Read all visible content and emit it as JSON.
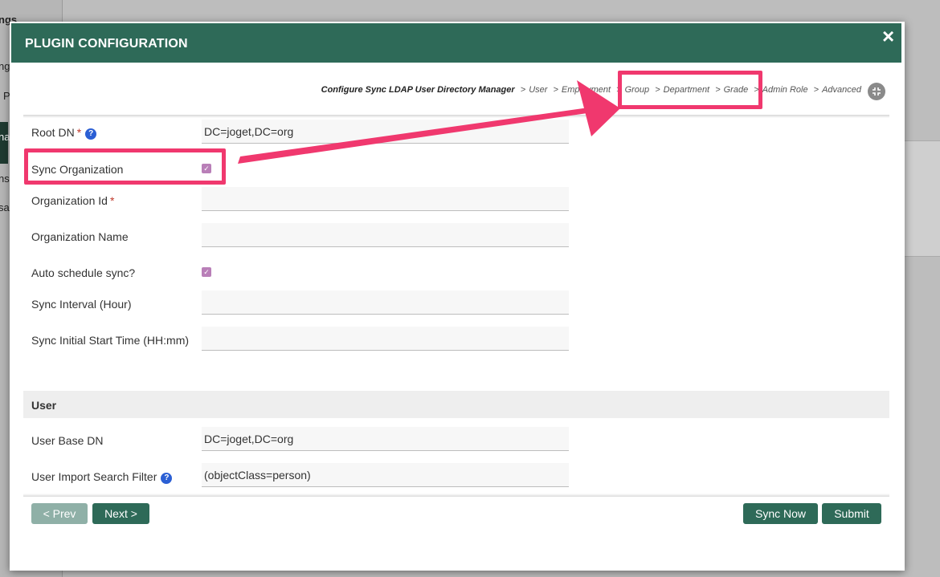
{
  "background": {
    "sidebar_fragments": [
      "ngs",
      "ng",
      "P",
      "na",
      "ns",
      "sa"
    ]
  },
  "modal": {
    "title": "PLUGIN CONFIGURATION",
    "close_glyph": "×"
  },
  "breadcrumb": {
    "root": "Configure Sync LDAP User Directory Manager",
    "separator": ">",
    "steps": [
      "User",
      "Employment",
      "Group",
      "Department",
      "Grade",
      "Admin Role",
      "Advanced"
    ],
    "collapse_icon": "collapse-icon"
  },
  "form": {
    "root_dn": {
      "label": "Root DN",
      "required": "*",
      "value": "DC=joget,DC=org"
    },
    "sync_organization": {
      "label": "Sync Organization",
      "checked": true
    },
    "organization_id": {
      "label": "Organization Id",
      "required": "*",
      "value": ""
    },
    "organization_name": {
      "label": "Organization Name",
      "value": ""
    },
    "auto_schedule": {
      "label": "Auto schedule sync?",
      "checked": true
    },
    "sync_interval": {
      "label": "Sync Interval (Hour)",
      "value": ""
    },
    "sync_start_time": {
      "label": "Sync Initial Start Time (HH:mm)",
      "value": ""
    },
    "user_section": {
      "title": "User"
    },
    "user_base_dn": {
      "label": "User Base DN",
      "value": "DC=joget,DC=org"
    },
    "user_import_filter": {
      "label": "User Import Search Filter",
      "value": "(objectClass=person)"
    },
    "help_glyph": "?",
    "check_glyph": "✓"
  },
  "buttons": {
    "prev": "< Prev",
    "next": "Next >",
    "sync_now": "Sync Now",
    "submit": "Submit"
  },
  "annotation": {
    "color": "#f0386e"
  },
  "colors": {
    "header": "#2e6a58",
    "checkbox": "#b97fb8",
    "help_icon": "#2b5fd4",
    "required": "#c0392b"
  }
}
